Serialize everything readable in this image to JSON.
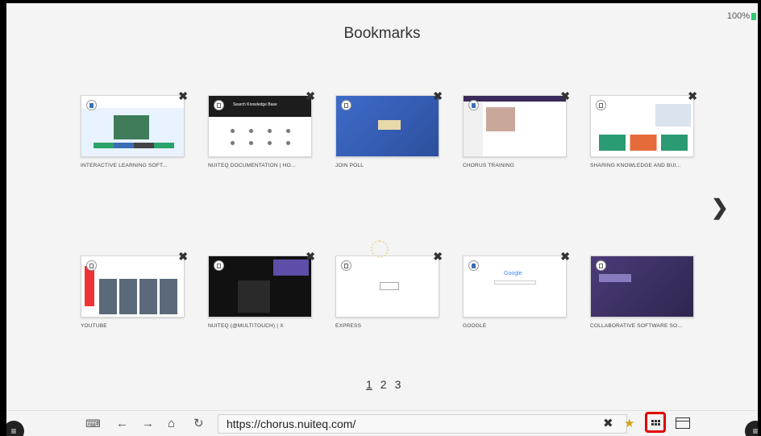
{
  "status": {
    "battery": "100%"
  },
  "page": {
    "title": "Bookmarks"
  },
  "bookmarks": [
    {
      "label": "INTERACTIVE LEARNING SOFT...",
      "icon": "bookmark-icon"
    },
    {
      "label": "NUITEQ DOCUMENTATION | HO...",
      "icon": "bookmark-outline-icon"
    },
    {
      "label": "JOIN POLL",
      "icon": "bookmark-outline-icon"
    },
    {
      "label": "CHORUS TRAINING",
      "icon": "bookmark-icon"
    },
    {
      "label": "SHARING KNOWLEDGE AND BUI...",
      "icon": "bookmark-outline-icon"
    },
    {
      "label": "YOUTUBE",
      "icon": "bookmark-outline-icon"
    },
    {
      "label": "NUITEQ (@MULTITOUCH) | X",
      "icon": "bookmark-outline-icon"
    },
    {
      "label": "EXPRESS",
      "icon": "bookmark-outline-icon"
    },
    {
      "label": "GOOGLE",
      "icon": "bookmark-icon"
    },
    {
      "label": "COLLABORATIVE SOFTWARE SO...",
      "icon": "bookmark-outline-icon"
    }
  ],
  "thumbs": {
    "doc_heading": "Search Knowledge Base",
    "google_logo": "Google"
  },
  "pagination": {
    "pages": [
      "1",
      "2",
      "3"
    ],
    "current": "1"
  },
  "toolbar": {
    "url": "https://chorus.nuiteq.com/",
    "back": "←",
    "forward": "→",
    "home": "⌂",
    "reload": "↻",
    "clear": "✖",
    "star": "★",
    "menu": "≡"
  },
  "colors": {
    "accent_highlight": "#e00000",
    "battery": "#2ecc71"
  }
}
